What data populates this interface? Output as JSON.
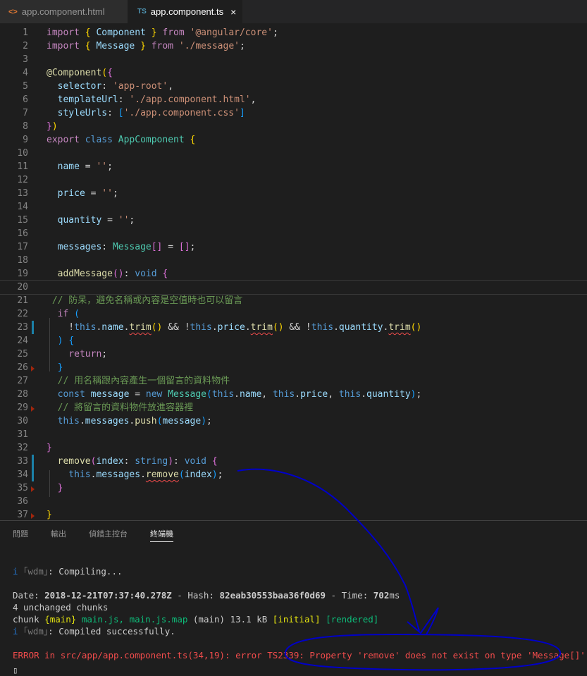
{
  "tabs": [
    {
      "icon": "<>",
      "label": "app.component.html"
    },
    {
      "icon": "TS",
      "label": "app.component.ts",
      "close": "×"
    }
  ],
  "editor": {
    "lines": [
      {
        "n": "1",
        "html": "<span class='kc'>import</span> <span class='b1'>{</span> <span class='v'>Component</span> <span class='b1'>}</span> <span class='kc'>from</span> <span class='s'>'@angular/core'</span>;"
      },
      {
        "n": "2",
        "html": "<span class='kc'>import</span> <span class='b1'>{</span> <span class='v'>Message</span> <span class='b1'>}</span> <span class='kc'>from</span> <span class='s'>'./message'</span>;"
      },
      {
        "n": "3",
        "html": ""
      },
      {
        "n": "4",
        "html": "<span class='f'>@Component</span><span class='b1'>(</span><span class='b2'>{</span>"
      },
      {
        "n": "5",
        "html": "  <span class='v'>selector</span>: <span class='s'>'app-root'</span>,"
      },
      {
        "n": "6",
        "html": "  <span class='v'>templateUrl</span>: <span class='s'>'./app.component.html'</span>,"
      },
      {
        "n": "7",
        "html": "  <span class='v'>styleUrls</span>: <span class='b3'>[</span><span class='s'>'./app.component.css'</span><span class='b3'>]</span>"
      },
      {
        "n": "8",
        "html": "<span class='b2'>}</span><span class='b1'>)</span>"
      },
      {
        "n": "9",
        "html": "<span class='kc'>export</span> <span class='k'>class</span> <span class='t'>AppComponent</span> <span class='b1'>{</span>"
      },
      {
        "n": "10",
        "html": ""
      },
      {
        "n": "11",
        "html": "  <span class='v'>name</span> = <span class='s'>''</span>;"
      },
      {
        "n": "12",
        "html": ""
      },
      {
        "n": "13",
        "html": "  <span class='v'>price</span> = <span class='s'>''</span>;"
      },
      {
        "n": "14",
        "html": ""
      },
      {
        "n": "15",
        "html": "  <span class='v'>quantity</span> = <span class='s'>''</span>;"
      },
      {
        "n": "16",
        "html": ""
      },
      {
        "n": "17",
        "html": "  <span class='v'>messages</span>: <span class='t'>Message</span><span class='b2'>[]</span> = <span class='b2'>[]</span>;"
      },
      {
        "n": "18",
        "html": ""
      },
      {
        "n": "19",
        "html": "  <span class='f'>addMessage</span><span class='b2'>()</span>: <span class='k'>void</span> <span class='b2'>{</span>"
      },
      {
        "n": "20",
        "html": "",
        "current": true
      },
      {
        "n": "21",
        "html": " <span class='c'>// 防呆，避免名稱或內容是空值時也可以留言</span>"
      },
      {
        "n": "22",
        "html": "  <span class='kc'>if</span> <span class='b3'>(</span>"
      },
      {
        "n": "23",
        "html": "    !<span class='k'>this</span>.<span class='v'>name</span>.<span class='f sq'>trim</span><span class='b1'>()</span> &amp;&amp; !<span class='k'>this</span>.<span class='v'>price</span>.<span class='f sq'>trim</span><span class='b1'>()</span> &amp;&amp; !<span class='k'>this</span>.<span class='v'>quantity</span>.<span class='f sq'>trim</span><span class='b1'>()</span>",
        "mod": true
      },
      {
        "n": "24",
        "html": "  <span class='b3'>)</span> <span class='b3'>{</span>"
      },
      {
        "n": "25",
        "html": "    <span class='kc'>return</span>;"
      },
      {
        "n": "26",
        "html": "  <span class='b3'>}</span>",
        "del": true
      },
      {
        "n": "27",
        "html": "  <span class='c'>// 用名稱跟內容產生一個留言的資料物件</span>"
      },
      {
        "n": "28",
        "html": "  <span class='k'>const</span> <span class='v'>message</span> = <span class='k'>new</span> <span class='t'>Message</span><span class='b3'>(</span><span class='k'>this</span>.<span class='v'>name</span>, <span class='k'>this</span>.<span class='v'>price</span>, <span class='k'>this</span>.<span class='v'>quantity</span><span class='b3'>)</span>;"
      },
      {
        "n": "29",
        "html": "  <span class='c'>// 將留言的資料物件放進容器裡</span>",
        "del": true
      },
      {
        "n": "30",
        "html": "  <span class='k'>this</span>.<span class='v'>messages</span>.<span class='f'>push</span><span class='b3'>(</span><span class='v'>message</span><span class='b3'>)</span>;"
      },
      {
        "n": "31",
        "html": ""
      },
      {
        "n": "32",
        "html": "<span class='b2'>}</span>"
      },
      {
        "n": "33",
        "html": "  <span class='f'>remove</span><span class='b2'>(</span><span class='v'>index</span>: <span class='k'>string</span><span class='b2'>)</span>: <span class='k'>void</span> <span class='b2'>{</span>",
        "mod": true
      },
      {
        "n": "34",
        "html": "    <span class='k'>this</span>.<span class='v'>messages</span>.<span class='f sq'>remove</span><span class='b3'>(</span><span class='v'>index</span><span class='b3'>)</span>;",
        "mod": true
      },
      {
        "n": "35",
        "html": "  <span class='b2'>}</span>",
        "del": true
      },
      {
        "n": "36",
        "html": ""
      },
      {
        "n": "37",
        "html": "<span class='b1'>}</span>",
        "del": true
      }
    ]
  },
  "panel": {
    "tabs": [
      "問題",
      "輸出",
      "偵錯主控台",
      "終端機"
    ],
    "active": "終端機"
  },
  "terminal": {
    "lines": [
      {
        "html": "<span class='blue'>i</span> <span class='gray'>｢wdm｣</span>: Compiling..."
      },
      {
        "html": ""
      },
      {
        "html": "Date: <b>2018-12-21T07:37:40.278Z</b> - Hash: <b>82eab30553baa36f0d69</b> - Time: <b>702</b>ms"
      },
      {
        "html": "4 unchanged chunks"
      },
      {
        "html": "chunk <span class='yel'>{</span><span class='yel'>main</span><span class='yel'>}</span> <span class='grn'>main.js, main.js.map</span> (main) 13.1 kB <span class='yel'>[initial]</span> <span class='grn'>[rendered]</span>"
      },
      {
        "html": "<span class='blue'>i</span> <span class='gray'>｢wdm｣</span>: Compiled successfully."
      },
      {
        "html": ""
      },
      {
        "html": "<span class='red'>ERROR in src/app/app.component.ts(34,19): error TS2339: Property 'remove' does not exist on type 'Message[]'.</span>"
      },
      {
        "html": "<span style='color:#cccccc'>▯</span>"
      }
    ]
  },
  "annotation_color": "#0000c8"
}
